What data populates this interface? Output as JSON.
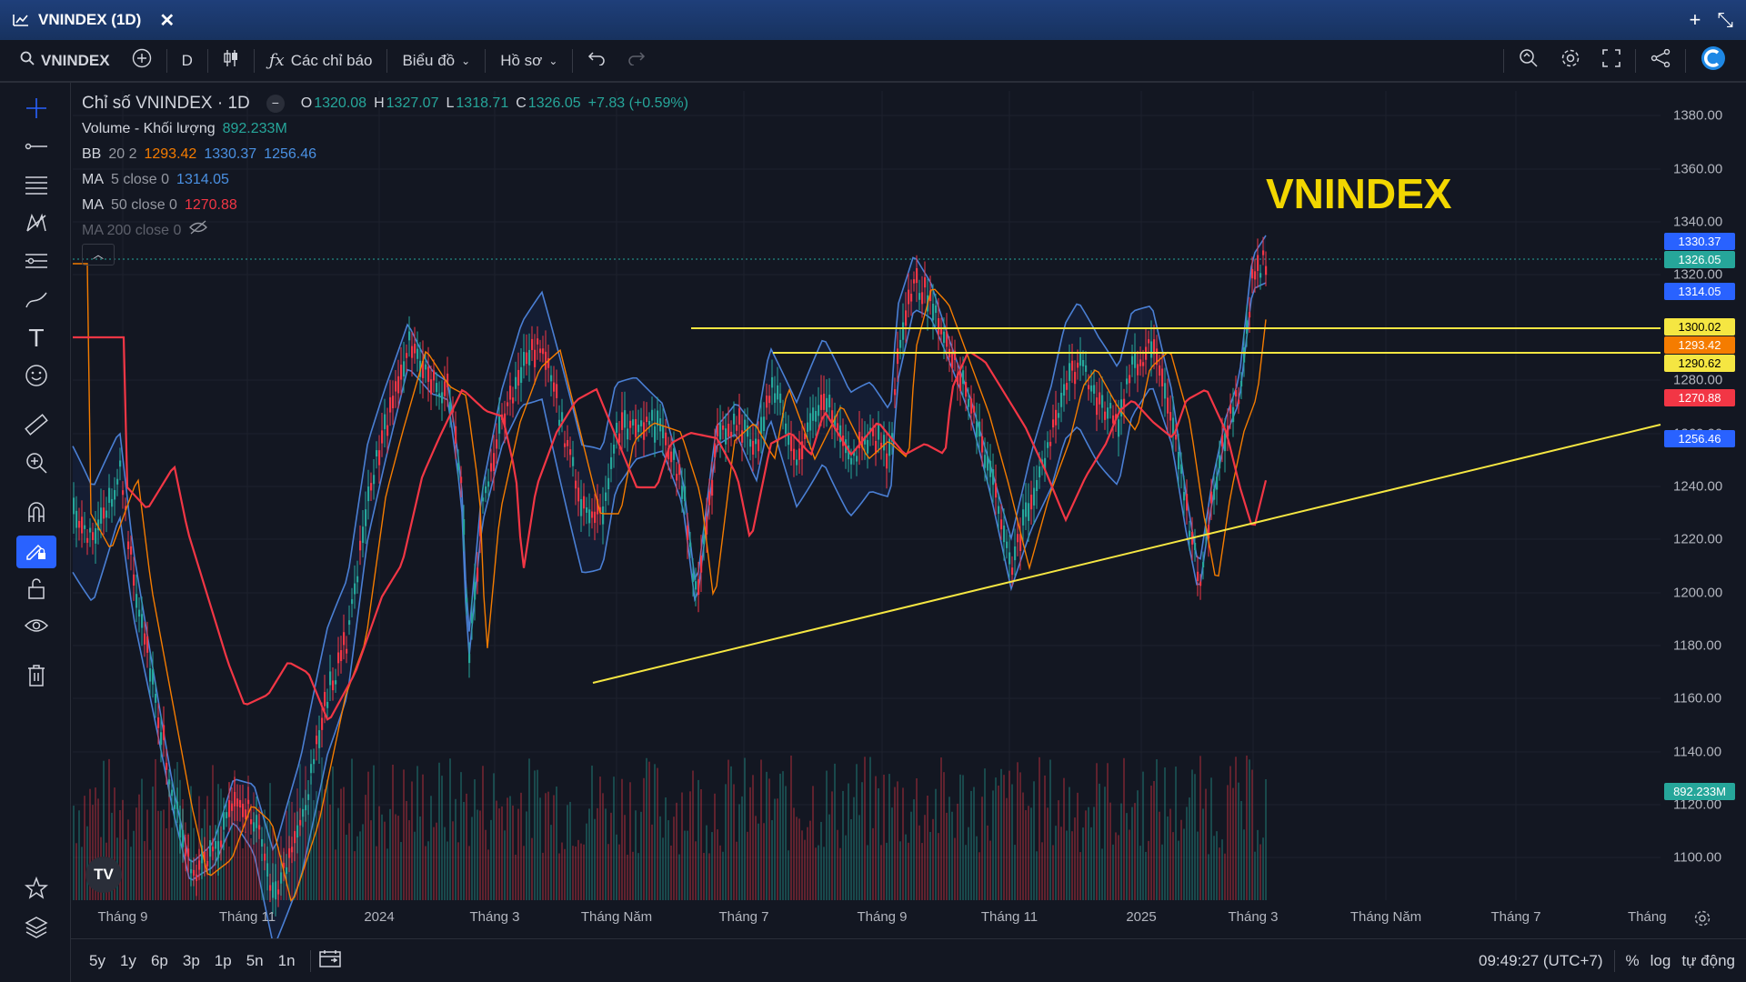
{
  "window": {
    "title": "VNINDEX (1D)"
  },
  "toolbar": {
    "symbol": "VNINDEX",
    "interval": "D",
    "indicators_label": "Các chỉ báo",
    "chart_label": "Biểu đồ",
    "profile_label": "Hồ sơ"
  },
  "legend": {
    "title": "Chỉ số VNINDEX · 1D",
    "ohlc": {
      "o_label": "O",
      "o": "1320.08",
      "h_label": "H",
      "h": "1327.07",
      "l_label": "L",
      "l": "1318.71",
      "c_label": "C",
      "c": "1326.05",
      "change": "+7.83 (+0.59%)"
    },
    "volume": {
      "name": "Volume - Khối lượng",
      "value": "892.233M"
    },
    "bb": {
      "name": "BB",
      "params": "20 2",
      "basis": "1293.42",
      "upper": "1330.37",
      "lower": "1256.46"
    },
    "ma5": {
      "name": "MA",
      "params": "5 close 0",
      "value": "1314.05"
    },
    "ma50": {
      "name": "MA",
      "params": "50 close 0",
      "value": "1270.88"
    },
    "ma200": {
      "name": "MA 200 close 0"
    }
  },
  "overlay_title": "VNINDEX",
  "price_tags": [
    {
      "value": "1330.37",
      "color": "#2962ff"
    },
    {
      "value": "1326.05",
      "color": "#26a69a"
    },
    {
      "value": "1314.05",
      "color": "#2962ff"
    },
    {
      "value": "1300.02",
      "color": "#f5e642"
    },
    {
      "value": "1293.42",
      "color": "#f57c00"
    },
    {
      "value": "1290.62",
      "color": "#f5e642"
    },
    {
      "value": "1270.88",
      "color": "#f23645"
    },
    {
      "value": "1256.46",
      "color": "#2962ff"
    },
    {
      "value": "892.233M",
      "color": "#26a69a"
    }
  ],
  "y_axis": [
    "1380.00",
    "1360.00",
    "1340.00",
    "1320.00",
    "1280.00",
    "1260.00",
    "1240.00",
    "1220.00",
    "1200.00",
    "1180.00",
    "1160.00",
    "1140.00",
    "1120.00",
    "1100.00"
  ],
  "x_axis": [
    "Tháng 9",
    "Tháng 11",
    "2024",
    "Tháng 3",
    "Tháng Năm",
    "Tháng 7",
    "Tháng 9",
    "Tháng 11",
    "2025",
    "Tháng 3",
    "Tháng Năm",
    "Tháng 7",
    "Tháng"
  ],
  "bottom": {
    "ranges": [
      "5y",
      "1y",
      "6p",
      "3p",
      "1p",
      "5n",
      "1n"
    ],
    "clock": "09:49:27 (UTC+7)",
    "percent": "%",
    "log": "log",
    "auto": "tự động"
  },
  "colors": {
    "bg": "#131722",
    "up": "#26a69a",
    "down": "#f23645",
    "bb": "#4a7fd4",
    "ma5": "#f57c00",
    "ma50": "#f23645",
    "level": "#f5e642"
  },
  "chart_data": {
    "type": "candlestick",
    "ylim": [
      1090,
      1390
    ],
    "levels": [
      1300.02,
      1290.62
    ],
    "last_close": 1326.05
  }
}
